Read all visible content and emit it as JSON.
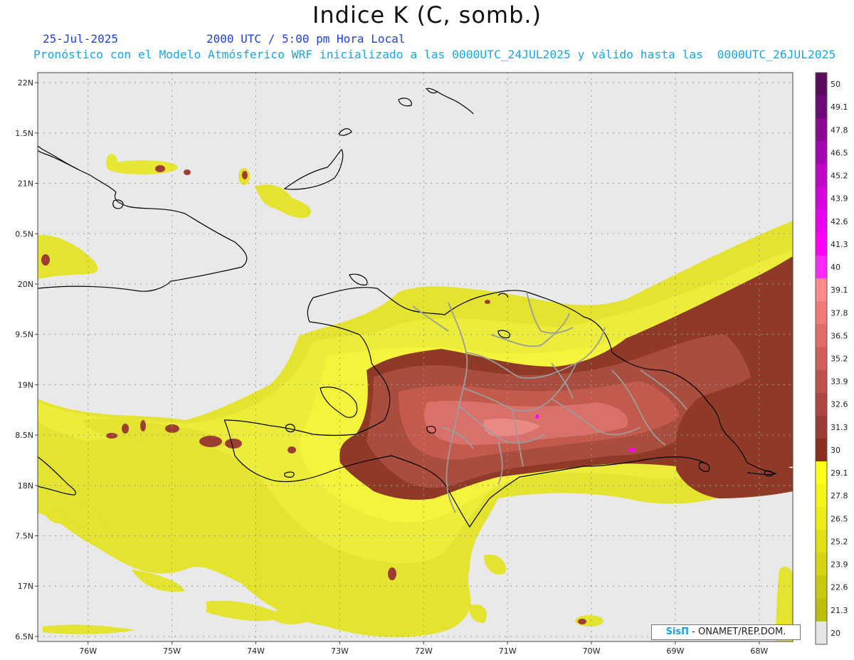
{
  "title": "Indice K (C, somb.)",
  "date_label": "25-Jul-2025",
  "time_label": "2000 UTC / 5:00 pm Hora Local",
  "description": "Pronóstico con el Modelo Atmósferico WRF inicializado a las 0000UTC_24JUL2025 y válido hasta las  0000UTC_26JUL2025",
  "credit": {
    "logo": "SisΠ",
    "text": "- ONAMET/REP.DOM."
  },
  "map": {
    "lon_range": [
      -76.6,
      -67.6
    ],
    "lat_range": [
      16.45,
      22.1
    ],
    "lat_labels": [
      "22N",
      "1.5N",
      "21N",
      "0.5N",
      "20N",
      "9.5N",
      "19N",
      "8.5N",
      "18N",
      "7.5N",
      "17N",
      "6.5N"
    ],
    "lat_values": [
      22,
      21.5,
      21,
      20.5,
      20,
      19.5,
      19,
      18.5,
      18,
      17.5,
      17,
      16.5
    ],
    "lon_labels": [
      "76W",
      "75W",
      "74W",
      "73W",
      "72W",
      "71W",
      "70W",
      "69W",
      "68W"
    ],
    "lon_values": [
      -76,
      -75,
      -74,
      -73,
      -72,
      -71,
      -70,
      -69,
      -68
    ]
  },
  "colorbar": {
    "labels": [
      "50",
      "49.1",
      "47.8",
      "46.5",
      "45.2",
      "43.9",
      "42.6",
      "41.3",
      "40",
      "39.1",
      "37.8",
      "36.5",
      "35.2",
      "33.9",
      "32.6",
      "31.3",
      "30",
      "29.1",
      "27.8",
      "26.5",
      "25.2",
      "23.9",
      "22.6",
      "21.3",
      "20"
    ],
    "colors": [
      "#5c0b5c",
      "#6e0a78",
      "#8a0894",
      "#a406b0",
      "#c004c8",
      "#d602dc",
      "#ea00ee",
      "#ff00ff",
      "#ff2aff",
      "#ff8a8a",
      "#ef7a76",
      "#df6c66",
      "#cf5f58",
      "#bf534b",
      "#ae4740",
      "#9d3c34",
      "#8a3020",
      "#ffff1a",
      "#f5f518",
      "#ebeb16",
      "#e0e014",
      "#d4d412",
      "#c9c910",
      "#bdbd0e",
      "#e6e6e6"
    ]
  }
}
